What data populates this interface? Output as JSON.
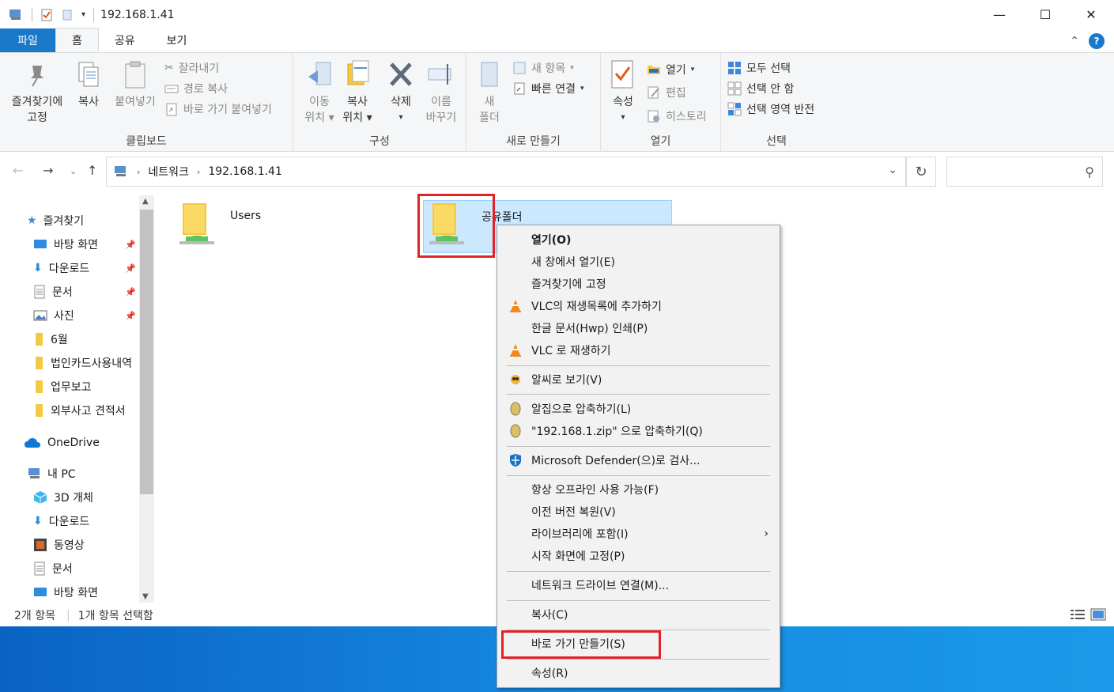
{
  "window": {
    "title": "192.168.1.41"
  },
  "tabs": [
    {
      "label": "파일"
    },
    {
      "label": "홈"
    },
    {
      "label": "공유"
    },
    {
      "label": "보기"
    }
  ],
  "ribbon": {
    "clipboard": {
      "pin_l1": "즐겨찾기에",
      "pin_l2": "고정",
      "copy": "복사",
      "paste": "붙여넣기",
      "cut": "잘라내기",
      "copy_path": "경로 복사",
      "paste_shortcut": "바로 가기 붙여넣기",
      "label": "클립보드"
    },
    "organize": {
      "move_l1": "이동",
      "move_l2": "위치",
      "copyto_l1": "복사",
      "copyto_l2": "위치",
      "delete": "삭제",
      "rename_l1": "이름",
      "rename_l2": "바꾸기",
      "label": "구성"
    },
    "new": {
      "folder_l1": "새",
      "folder_l2": "폴더",
      "new_item": "새 항목",
      "easy_access": "빠른 연결",
      "label": "새로 만들기"
    },
    "open": {
      "properties": "속성",
      "open": "열기",
      "edit": "편집",
      "history": "히스토리",
      "label": "열기"
    },
    "select": {
      "select_all": "모두 선택",
      "select_none": "선택 안 함",
      "invert": "선택 영역 반전",
      "label": "선택"
    }
  },
  "address": {
    "crumbs": [
      "네트워크",
      "192.168.1.41"
    ]
  },
  "sidebar": {
    "favorites": "즐겨찾기",
    "items": [
      {
        "label": "바탕 화면"
      },
      {
        "label": "다운로드"
      },
      {
        "label": "문서"
      },
      {
        "label": "사진"
      },
      {
        "label": "6월"
      },
      {
        "label": "법인카드사용내역"
      },
      {
        "label": "업무보고"
      },
      {
        "label": "외부사고 견적서"
      }
    ],
    "onedrive": "OneDrive",
    "mypc": "내 PC",
    "pc_items": [
      {
        "label": "3D 개체"
      },
      {
        "label": "다운로드"
      },
      {
        "label": "동영상"
      },
      {
        "label": "문서"
      },
      {
        "label": "바탕 화면"
      }
    ]
  },
  "content": {
    "items": [
      {
        "label": "Users"
      },
      {
        "label": "공유폴더"
      }
    ]
  },
  "status": {
    "count": "2개 항목",
    "selected": "1개 항목 선택함"
  },
  "context_menu": {
    "items": [
      {
        "label": "열기(O)"
      },
      {
        "label": "새 창에서 열기(E)"
      },
      {
        "label": "즐겨찾기에 고정"
      },
      {
        "label": "VLC의 재생목록에 추가하기"
      },
      {
        "label": "한글 문서(Hwp) 인쇄(P)"
      },
      {
        "label": "VLC 로 재생하기"
      },
      {
        "label": "알씨로 보기(V)"
      },
      {
        "label": "알집으로 압축하기(L)"
      },
      {
        "label": "\"192.168.1.zip\" 으로 압축하기(Q)"
      },
      {
        "label": "Microsoft Defender(으)로 검사..."
      },
      {
        "label": "항상 오프라인 사용 가능(F)"
      },
      {
        "label": "이전 버전 복원(V)"
      },
      {
        "label": "라이브러리에 포함(I)"
      },
      {
        "label": "시작 화면에 고정(P)"
      },
      {
        "label": "네트워크 드라이브 연결(M)..."
      },
      {
        "label": "복사(C)"
      },
      {
        "label": "바로 가기 만들기(S)"
      },
      {
        "label": "속성(R)"
      }
    ]
  },
  "colors": {
    "accent": "#1979ca",
    "selection": "#cce8ff",
    "highlight": "#e32228"
  }
}
